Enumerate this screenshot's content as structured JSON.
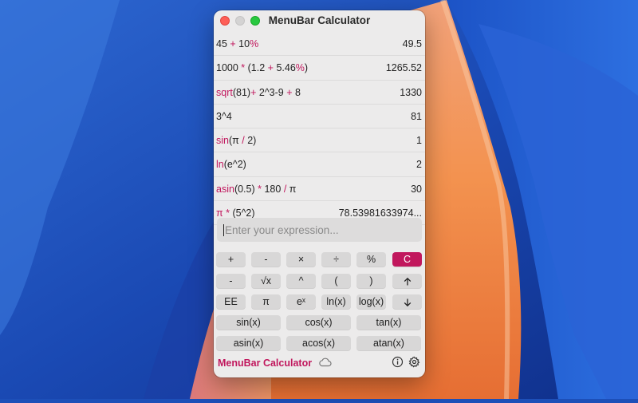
{
  "window": {
    "title": "MenuBar Calculator"
  },
  "history": [
    {
      "expr_parts": [
        {
          "t": "45 ",
          "hl": false
        },
        {
          "t": "+",
          "hl": true
        },
        {
          "t": " 10",
          "hl": false
        },
        {
          "t": "%",
          "hl": true
        }
      ],
      "result": "49.5"
    },
    {
      "expr_parts": [
        {
          "t": "1000 ",
          "hl": false
        },
        {
          "t": "*",
          "hl": true
        },
        {
          "t": " (1.2 ",
          "hl": false
        },
        {
          "t": "+",
          "hl": true
        },
        {
          "t": " 5.46",
          "hl": false
        },
        {
          "t": "%",
          "hl": true
        },
        {
          "t": ")",
          "hl": false
        }
      ],
      "result": "1265.52"
    },
    {
      "expr_parts": [
        {
          "t": "sqrt",
          "hl": true
        },
        {
          "t": "(81)",
          "hl": false
        },
        {
          "t": "+",
          "hl": true
        },
        {
          "t": " 2^3-9 ",
          "hl": false
        },
        {
          "t": "+",
          "hl": true
        },
        {
          "t": " 8",
          "hl": false
        }
      ],
      "result": "1330"
    },
    {
      "expr_parts": [
        {
          "t": "3^4",
          "hl": false
        }
      ],
      "result": "81"
    },
    {
      "expr_parts": [
        {
          "t": "sin",
          "hl": true
        },
        {
          "t": "(π ",
          "hl": false
        },
        {
          "t": "/",
          "hl": true
        },
        {
          "t": " 2)",
          "hl": false
        }
      ],
      "result": "1"
    },
    {
      "expr_parts": [
        {
          "t": "ln",
          "hl": true
        },
        {
          "t": "(e^2)",
          "hl": false
        }
      ],
      "result": "2"
    },
    {
      "expr_parts": [
        {
          "t": "asin",
          "hl": true
        },
        {
          "t": "(0.5) ",
          "hl": false
        },
        {
          "t": "*",
          "hl": true
        },
        {
          "t": " 180 ",
          "hl": false
        },
        {
          "t": "/",
          "hl": true
        },
        {
          "t": " π",
          "hl": false
        }
      ],
      "result": "30"
    },
    {
      "expr_parts": [
        {
          "t": "π ",
          "hl": true
        },
        {
          "t": "*",
          "hl": true
        },
        {
          "t": " (5^2)",
          "hl": false
        }
      ],
      "result": "78.53981633974..."
    }
  ],
  "input": {
    "placeholder": "Enter your expression...",
    "value": ""
  },
  "keypad": {
    "row1": [
      {
        "label": "+",
        "name": "plus-button"
      },
      {
        "label": "-",
        "name": "minus-button"
      },
      {
        "label": "×",
        "name": "multiply-button"
      },
      {
        "label": "÷",
        "name": "divide-button"
      },
      {
        "label": "%",
        "name": "percent-button"
      },
      {
        "label": "C",
        "name": "clear-button",
        "accent": true
      }
    ],
    "row2": [
      {
        "label": "-",
        "name": "negate-button"
      },
      {
        "label": "√x",
        "name": "sqrt-button"
      },
      {
        "label": "^",
        "name": "power-button"
      },
      {
        "label": "(",
        "name": "open-paren-button"
      },
      {
        "label": ")",
        "name": "close-paren-button"
      },
      {
        "label": "",
        "name": "history-up-button",
        "icon": "arrow-up-icon"
      }
    ],
    "row3": [
      {
        "label": "EE",
        "name": "ee-button"
      },
      {
        "label": "π",
        "name": "pi-button"
      },
      {
        "label": "eˣ",
        "name": "exp-button"
      },
      {
        "label": "ln(x)",
        "name": "ln-button"
      },
      {
        "label": "log(x)",
        "name": "log-button"
      },
      {
        "label": "",
        "name": "history-down-button",
        "icon": "arrow-down-icon"
      }
    ],
    "row4": [
      {
        "label": "sin(x)",
        "name": "sin-button"
      },
      {
        "label": "cos(x)",
        "name": "cos-button"
      },
      {
        "label": "tan(x)",
        "name": "tan-button"
      }
    ],
    "row5": [
      {
        "label": "asin(x)",
        "name": "asin-button"
      },
      {
        "label": "acos(x)",
        "name": "acos-button"
      },
      {
        "label": "atan(x)",
        "name": "atan-button"
      }
    ]
  },
  "footer": {
    "brand": "MenuBar Calculator",
    "icons": [
      "cloud-icon",
      "info-icon",
      "gear-icon"
    ]
  },
  "colors": {
    "accent": "#c1175d",
    "window_bg": "#ecebeb",
    "button_bg": "#d8d7d7"
  }
}
